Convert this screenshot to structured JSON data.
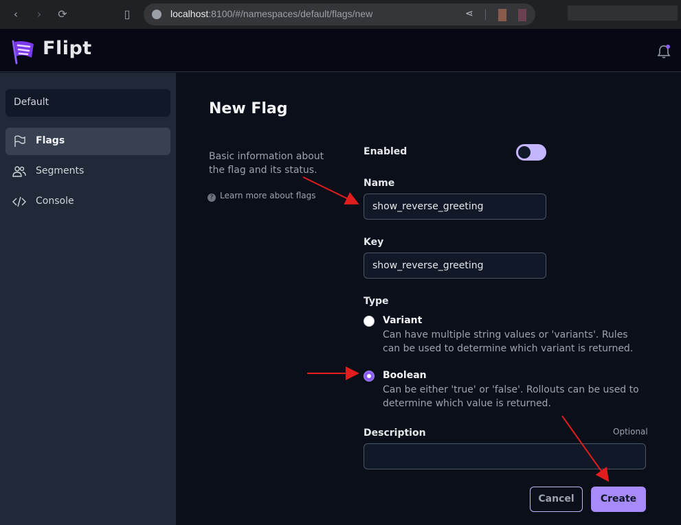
{
  "browser": {
    "url_host": "localhost",
    "url_path": ":8100/#/namespaces/default/flags/new"
  },
  "header": {
    "app_name": "Flipt"
  },
  "sidebar": {
    "namespace": "Default",
    "items": [
      {
        "label": "Flags",
        "icon": "flag-icon",
        "active": true
      },
      {
        "label": "Segments",
        "icon": "users-icon",
        "active": false
      },
      {
        "label": "Console",
        "icon": "code-icon",
        "active": false
      }
    ]
  },
  "main": {
    "title": "New Flag",
    "section_description": "Basic information about the flag and its status.",
    "learn_more": "Learn more about flags",
    "enabled_label": "Enabled",
    "enabled": false,
    "name_label": "Name",
    "name_value": "show_reverse_greeting",
    "key_label": "Key",
    "key_value": "show_reverse_greeting",
    "type_label": "Type",
    "types": [
      {
        "title": "Variant",
        "description": "Can have multiple string values or 'variants'. Rules can be used to determine which variant is returned.",
        "selected": false
      },
      {
        "title": "Boolean",
        "description": "Can be either 'true' or 'false'. Rollouts can be used to determine which value is returned.",
        "selected": true
      }
    ],
    "description_label": "Description",
    "description_hint": "Optional",
    "cancel_label": "Cancel",
    "create_label": "Create"
  },
  "colors": {
    "accent": "#a78bfa",
    "annotation_arrow": "#e11d1d"
  }
}
